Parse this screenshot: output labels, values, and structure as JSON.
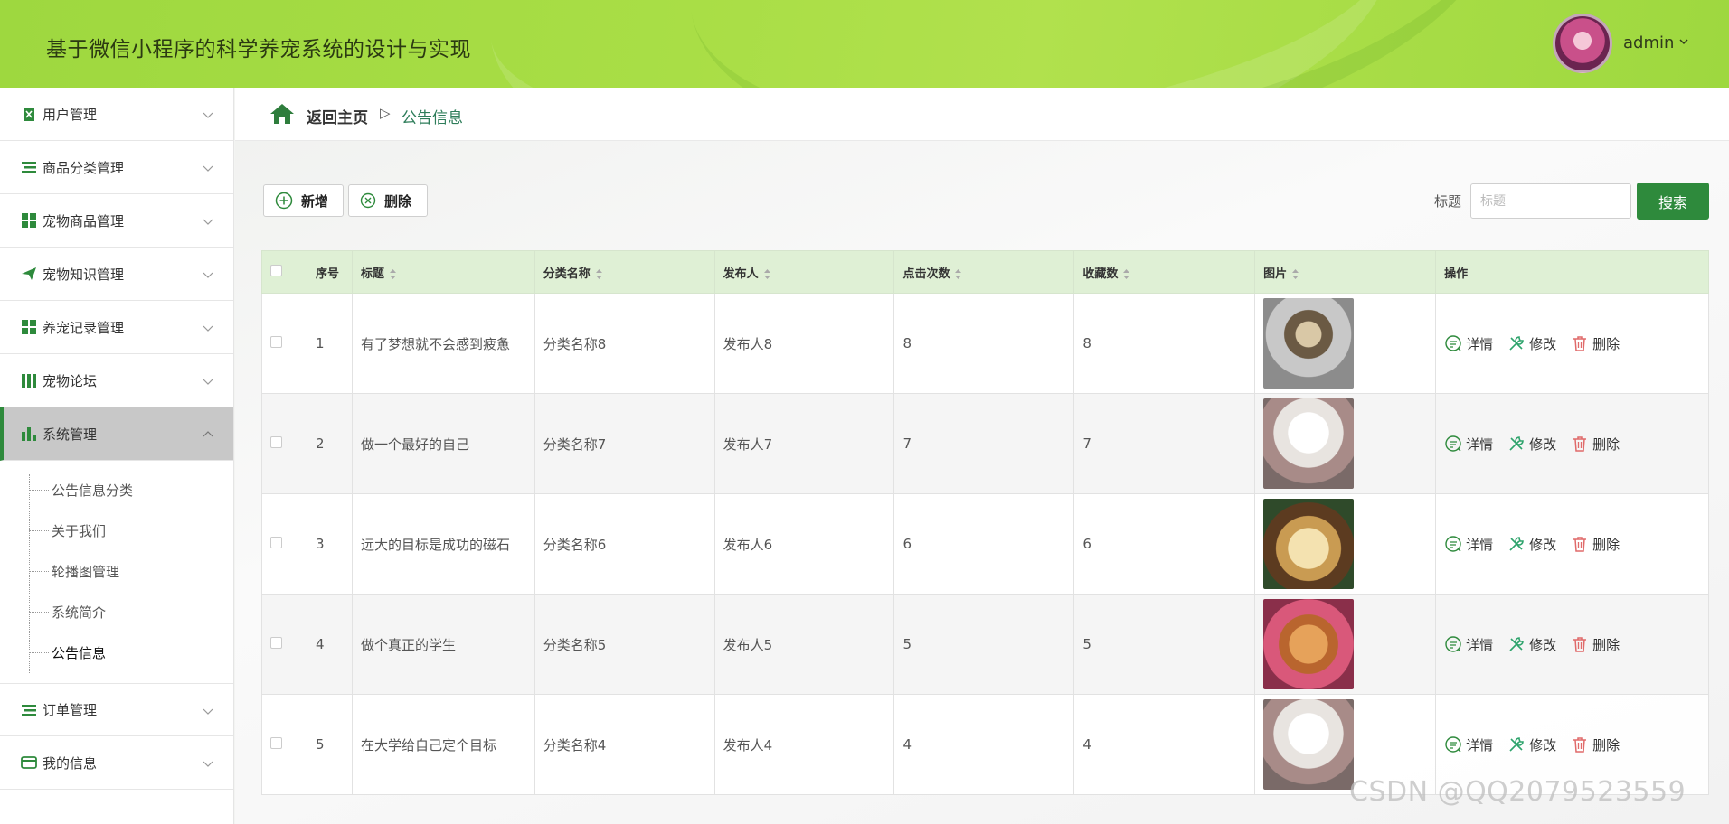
{
  "header": {
    "title": "基于微信小程序的科学养宠系统的设计与实现",
    "user": "admin"
  },
  "sidebar": {
    "items": [
      {
        "label": "用户管理",
        "icon": "clipboard-icon"
      },
      {
        "label": "商品分类管理",
        "icon": "list-icon"
      },
      {
        "label": "宠物商品管理",
        "icon": "grid-icon"
      },
      {
        "label": "宠物知识管理",
        "icon": "send-icon"
      },
      {
        "label": "养宠记录管理",
        "icon": "grid-icon"
      },
      {
        "label": "宠物论坛",
        "icon": "books-icon"
      },
      {
        "label": "系统管理",
        "icon": "bar-chart-icon"
      },
      {
        "label": "订单管理",
        "icon": "list-icon"
      },
      {
        "label": "我的信息",
        "icon": "card-icon"
      }
    ],
    "submenu": [
      "公告信息分类",
      "关于我们",
      "轮播图管理",
      "系统简介",
      "公告信息"
    ]
  },
  "breadcrumb": {
    "home": "返回主页",
    "separator": "▷",
    "current": "公告信息"
  },
  "toolbar": {
    "add_label": "新增",
    "delete_label": "删除",
    "search_label": "标题",
    "search_placeholder": "标题",
    "search_button": "搜索"
  },
  "table": {
    "columns": [
      "序号",
      "标题",
      "分类名称",
      "发布人",
      "点击次数",
      "收藏数",
      "图片",
      "操作"
    ],
    "rows": [
      {
        "no": "1",
        "title": "有了梦想就不会感到疲惫",
        "category": "分类名称8",
        "publisher": "发布人8",
        "clicks": "8",
        "favorites": "8"
      },
      {
        "no": "2",
        "title": "做一个最好的自己",
        "category": "分类名称7",
        "publisher": "发布人7",
        "clicks": "7",
        "favorites": "7"
      },
      {
        "no": "3",
        "title": "远大的目标是成功的磁石",
        "category": "分类名称6",
        "publisher": "发布人6",
        "clicks": "6",
        "favorites": "6"
      },
      {
        "no": "4",
        "title": "做个真正的学生",
        "category": "分类名称5",
        "publisher": "发布人5",
        "clicks": "5",
        "favorites": "5"
      },
      {
        "no": "5",
        "title": "在大学给自己定个目标",
        "category": "分类名称4",
        "publisher": "发布人4",
        "clicks": "4",
        "favorites": "4"
      }
    ],
    "actions": {
      "detail": "详情",
      "edit": "修改",
      "delete": "删除"
    }
  },
  "colors": {
    "accent": "#2e8a3c",
    "header": "#a9de46",
    "table_head": "#dff0d5"
  },
  "watermark": "CSDN @QQ2079523559"
}
